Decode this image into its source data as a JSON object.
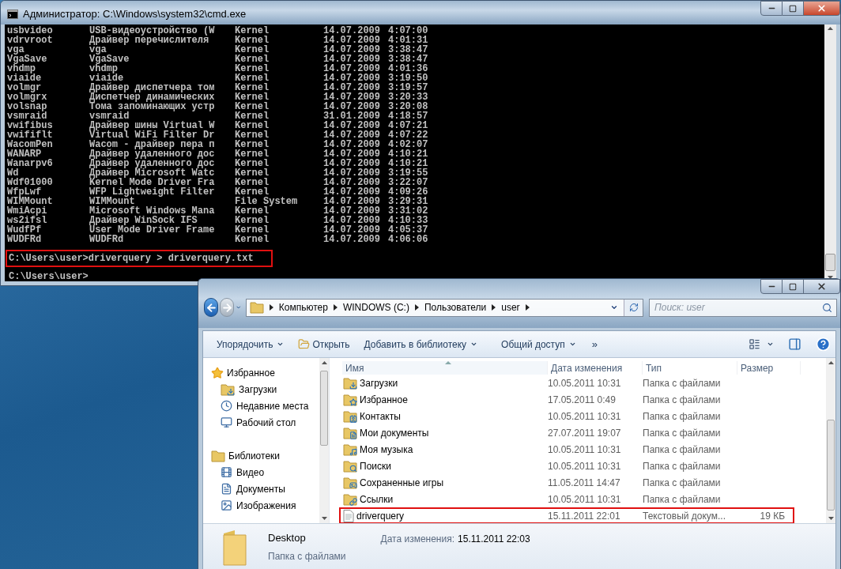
{
  "console_window": {
    "title": "Администратор: C:\\Windows\\system32\\cmd.exe",
    "output_rows": [
      {
        "name": "usbvideo",
        "description": "USB-видеоустройство (W",
        "type": "Kernel",
        "date": "14.07.2009",
        "time": "4:07:00"
      },
      {
        "name": "vdrvroot",
        "description": "Драйвер перечислителя",
        "type": "Kernel",
        "date": "14.07.2009",
        "time": "4:01:31"
      },
      {
        "name": "vga",
        "description": "vga",
        "type": "Kernel",
        "date": "14.07.2009",
        "time": "3:38:47"
      },
      {
        "name": "VgaSave",
        "description": "VgaSave",
        "type": "Kernel",
        "date": "14.07.2009",
        "time": "3:38:47"
      },
      {
        "name": "vhdmp",
        "description": "vhdmp",
        "type": "Kernel",
        "date": "14.07.2009",
        "time": "4:01:36"
      },
      {
        "name": "viaide",
        "description": "viaide",
        "type": "Kernel",
        "date": "14.07.2009",
        "time": "3:19:50"
      },
      {
        "name": "volmgr",
        "description": "Драйвер диспетчера том",
        "type": "Kernel",
        "date": "14.07.2009",
        "time": "3:19:57"
      },
      {
        "name": "volmgrx",
        "description": "Диспетчер динамических",
        "type": "Kernel",
        "date": "14.07.2009",
        "time": "3:20:33"
      },
      {
        "name": "volsnap",
        "description": "Тома запоминающих устр",
        "type": "Kernel",
        "date": "14.07.2009",
        "time": "3:20:08"
      },
      {
        "name": "vsmraid",
        "description": "vsmraid",
        "type": "Kernel",
        "date": "31.01.2009",
        "time": "4:18:57"
      },
      {
        "name": "vwifibus",
        "description": "Драйвер шины Virtual W",
        "type": "Kernel",
        "date": "14.07.2009",
        "time": "4:07:21"
      },
      {
        "name": "vwififlt",
        "description": "Virtual WiFi Filter Dr",
        "type": "Kernel",
        "date": "14.07.2009",
        "time": "4:07:22"
      },
      {
        "name": "WacomPen",
        "description": "Wacom - драйвер пера п",
        "type": "Kernel",
        "date": "14.07.2009",
        "time": "4:02:07"
      },
      {
        "name": "WANARP",
        "description": "Драйвер удаленного дос",
        "type": "Kernel",
        "date": "14.07.2009",
        "time": "4:10:21"
      },
      {
        "name": "Wanarpv6",
        "description": "Драйвер удаленного дос",
        "type": "Kernel",
        "date": "14.07.2009",
        "time": "4:10:21"
      },
      {
        "name": "Wd",
        "description": "Драйвер Microsoft Watc",
        "type": "Kernel",
        "date": "14.07.2009",
        "time": "3:19:55"
      },
      {
        "name": "Wdf01000",
        "description": "Kernel Mode Driver Fra",
        "type": "Kernel",
        "date": "14.07.2009",
        "time": "3:22:07"
      },
      {
        "name": "WfpLwf",
        "description": "WFP Lightweight Filter",
        "type": "Kernel",
        "date": "14.07.2009",
        "time": "4:09:26"
      },
      {
        "name": "WIMMount",
        "description": "WIMMount",
        "type": "File System",
        "date": "14.07.2009",
        "time": "3:29:31"
      },
      {
        "name": "WmiAcpi",
        "description": "Microsoft Windows Mana",
        "type": "Kernel",
        "date": "14.07.2009",
        "time": "3:31:02"
      },
      {
        "name": "ws2ifsl",
        "description": "Драйвер WinSock IFS",
        "type": "Kernel",
        "date": "14.07.2009",
        "time": "4:10:33"
      },
      {
        "name": "WudfPf",
        "description": "User Mode Driver Frame",
        "type": "Kernel",
        "date": "14.07.2009",
        "time": "4:05:37"
      },
      {
        "name": "WUDFRd",
        "description": "WUDFRd",
        "type": "Kernel",
        "date": "14.07.2009",
        "time": "4:06:06"
      }
    ],
    "prompt_lines": [
      {
        "text": "C:\\Users\\user>driverquery > driverquery.txt",
        "highlighted": true
      },
      {
        "text": "C:\\Users\\user>",
        "highlighted": false
      }
    ]
  },
  "explorer_window": {
    "breadcrumb": [
      "Компьютер",
      "WINDOWS (C:)",
      "Пользователи",
      "user"
    ],
    "search": {
      "placeholder": "Поиск: user"
    },
    "toolbar": [
      {
        "label": "Упорядочить",
        "kind": "menu"
      },
      {
        "label": "Открыть",
        "kind": "button"
      },
      {
        "label": "Добавить в библиотеку",
        "kind": "menu"
      },
      {
        "label": "Общий доступ",
        "kind": "menu"
      },
      {
        "label": "»",
        "kind": "overflow"
      }
    ],
    "navigation": [
      {
        "label": "Избранное",
        "kind": "star",
        "children": [
          {
            "label": "Загрузки",
            "kind": "download"
          },
          {
            "label": "Недавние места",
            "kind": "recent"
          },
          {
            "label": "Рабочий стол",
            "kind": "desktop"
          }
        ]
      },
      {
        "label": "Библиотеки",
        "kind": "library",
        "children": [
          {
            "label": "Видео",
            "kind": "video"
          },
          {
            "label": "Документы",
            "kind": "document"
          },
          {
            "label": "Изображения",
            "kind": "image"
          }
        ]
      }
    ],
    "columns": [
      {
        "label": "Имя",
        "sorted": true
      },
      {
        "label": "Дата изменения",
        "sorted": false
      },
      {
        "label": "Тип",
        "sorted": false
      },
      {
        "label": "Размер",
        "sorted": false
      }
    ],
    "files": [
      {
        "name": "Загрузки",
        "date": "10.05.2011 10:31",
        "type": "Папка с файлами",
        "kind": "download",
        "highlighted": false
      },
      {
        "name": "Избранное",
        "date": "17.05.2011 0:49",
        "type": "Папка с файлами",
        "kind": "star",
        "highlighted": false
      },
      {
        "name": "Контакты",
        "date": "10.05.2011 10:31",
        "type": "Папка с файлами",
        "kind": "contact",
        "highlighted": false
      },
      {
        "name": "Мои документы",
        "date": "27.07.2011 19:07",
        "type": "Папка с файлами",
        "kind": "document",
        "highlighted": false
      },
      {
        "name": "Моя музыка",
        "date": "10.05.2011 10:31",
        "type": "Папка с файлами",
        "kind": "music",
        "highlighted": false
      },
      {
        "name": "Поиски",
        "date": "10.05.2011 10:31",
        "type": "Папка с файлами",
        "kind": "search",
        "highlighted": false
      },
      {
        "name": "Сохраненные игры",
        "date": "11.05.2011 14:47",
        "type": "Папка с файлами",
        "kind": "game",
        "highlighted": false
      },
      {
        "name": "Ссылки",
        "date": "10.05.2011 10:31",
        "type": "Папка с файлами",
        "kind": "link",
        "highlighted": false
      },
      {
        "name": "driverquery",
        "date": "15.11.2011 22:01",
        "type": "Текстовый докум...",
        "size": "19 КБ",
        "kind": "text",
        "highlighted": true
      }
    ],
    "details": {
      "name": "Desktop",
      "type": "Папка с файлами",
      "date_label": "Дата изменения:",
      "date": "15.11.2011 22:03"
    }
  }
}
